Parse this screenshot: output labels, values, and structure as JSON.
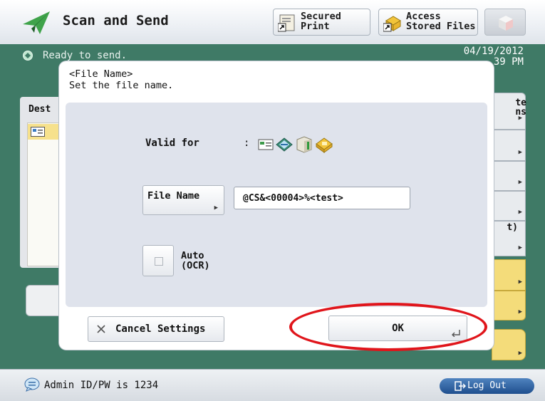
{
  "header": {
    "title": "Scan and Send",
    "secured_print": "Secured\nPrint",
    "stored_files": "Access\nStored Files",
    "app_icon": "paper-plane-icon",
    "secured_print_icon": "secured-print-icon",
    "stored_files_icon": "stored-files-icon",
    "cube_icon": "cube-icon"
  },
  "status": {
    "text": "Ready to send.",
    "datetime": "04/19/2012\n39 PM"
  },
  "background": {
    "dest_label": "Dest",
    "right_buttons": [
      "te\nns",
      "",
      "",
      "t)",
      "",
      ""
    ]
  },
  "dialog": {
    "title": "<File Name>",
    "subtitle": "Set the file name.",
    "valid_for_label": "Valid for",
    "valid_for_colon": ":",
    "valid_icons": [
      "email-icon",
      "ifax-icon",
      "file-server-icon",
      "mailbox-icon"
    ],
    "file_name_button": "File Name",
    "file_name_value": "@CS&<00004>%<test>",
    "auto_ocr_label": "Auto\n(OCR)",
    "auto_ocr_checked": false,
    "cancel_label": "Cancel Settings",
    "ok_label": "OK"
  },
  "bottom": {
    "message": "Admin ID/PW is 1234",
    "logout": "Log Out"
  },
  "colors": {
    "accent_green": "#3f7a66",
    "highlight_red": "#e0151b",
    "logout_blue": "#2a5b9a",
    "bg_yellow": "#f4dc7a"
  }
}
